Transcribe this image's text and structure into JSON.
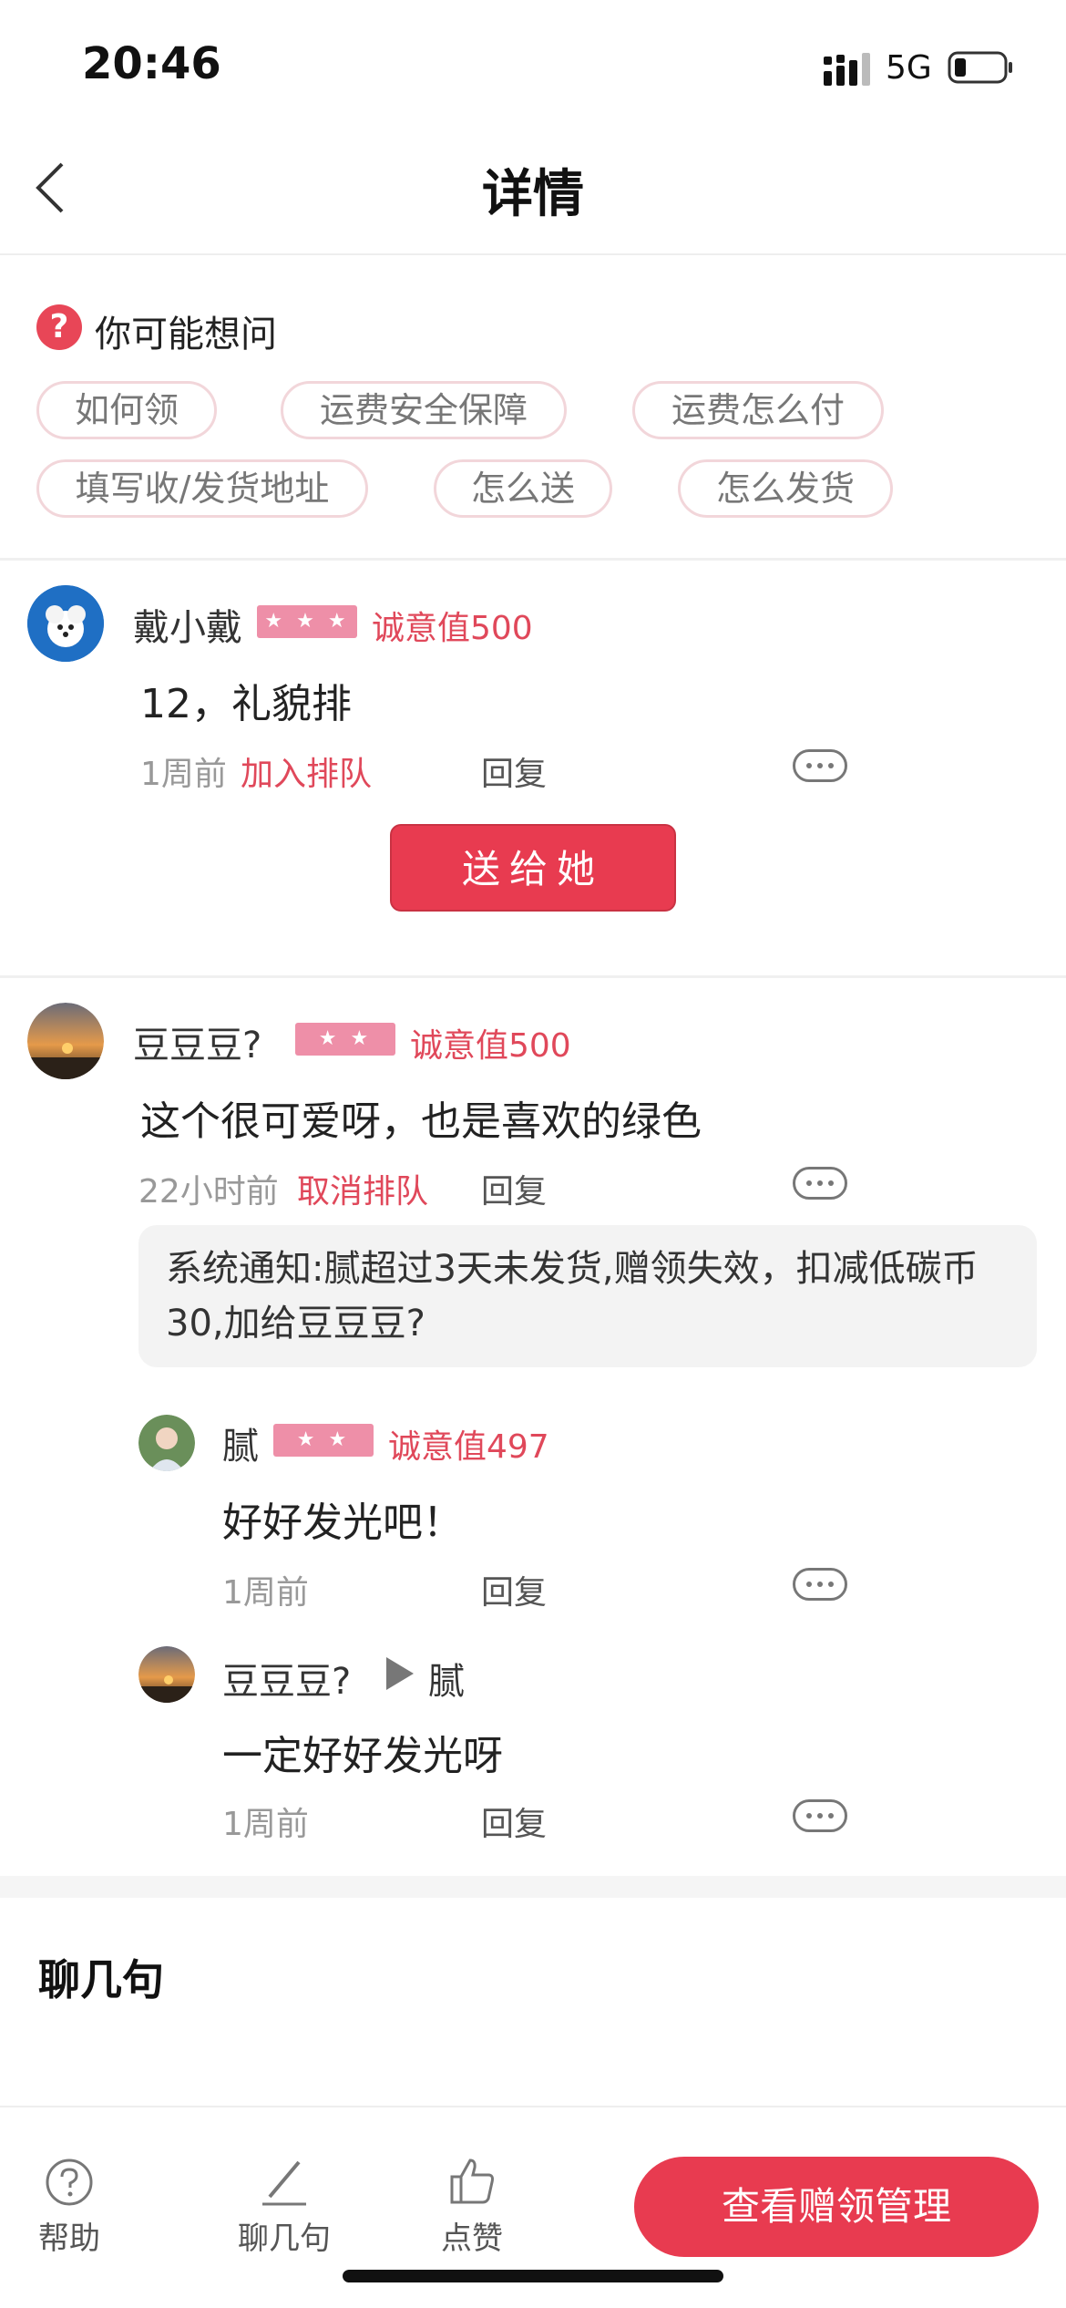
{
  "status_bar": {
    "time": "20:46",
    "network": "5G"
  },
  "nav": {
    "title": "详情"
  },
  "faq": {
    "title": "你可能想问",
    "chips": [
      "如何领",
      "运费安全保障",
      "运费怎么付",
      "填写收/发货地址",
      "怎么送",
      "怎么发货"
    ]
  },
  "comments": [
    {
      "user": "戴小戴",
      "stars": "★ ★ ★",
      "score": "诚意值500",
      "content": "12，礼貌排",
      "time": "1周前",
      "action": "加入排队",
      "reply": "回复",
      "give_button": "送给她"
    },
    {
      "user": "豆豆豆?",
      "stars": "★ ★",
      "score": "诚意值500",
      "content": "这个很可爱呀，也是喜欢的绿色",
      "time": "22小时前",
      "action": "取消排队",
      "reply": "回复",
      "notice": "系统通知:腻超过3天未发货,赠领失效，扣减低碳币30,加给豆豆豆?"
    }
  ],
  "replies": [
    {
      "user": "腻",
      "stars": "★ ★",
      "score": "诚意值497",
      "content": "好好发光吧！",
      "time": "1周前",
      "reply": "回复"
    },
    {
      "user": "豆豆豆?",
      "to_user": "腻",
      "content": "一定好好发光呀",
      "time": "1周前",
      "reply": "回复"
    }
  ],
  "chat": {
    "title": "聊几句"
  },
  "bottom_bar": {
    "help": "帮助",
    "chat": "聊几句",
    "like": "点赞",
    "cta": "查看赠领管理"
  },
  "colors": {
    "accent": "#e83b50",
    "star_badge": "#ee8fa8",
    "chip_border": "#f2d6da"
  }
}
